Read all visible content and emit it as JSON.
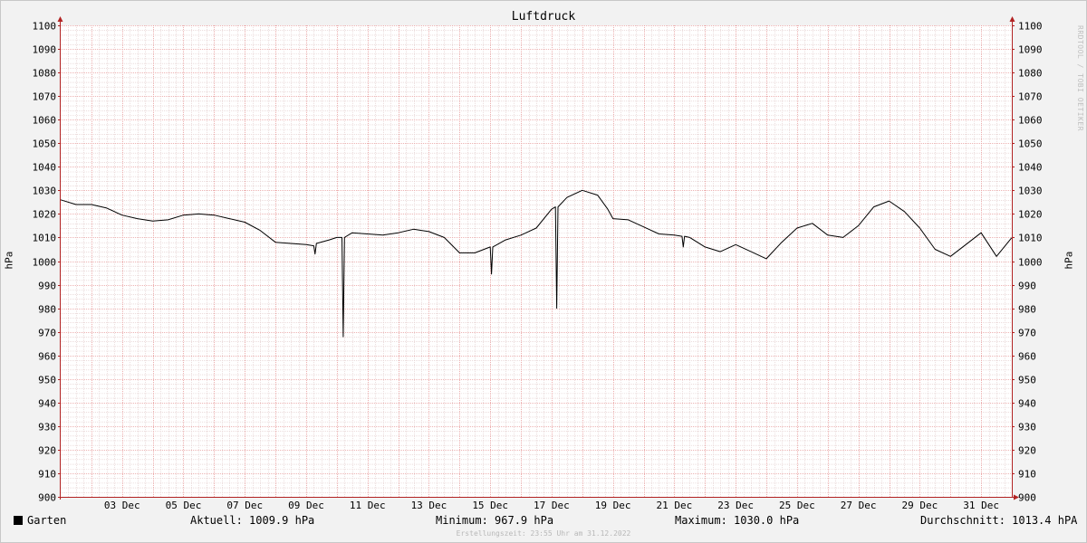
{
  "chart_data": {
    "type": "line",
    "title": "Luftdruck",
    "ylabel": "hPa",
    "ylim": [
      900,
      1100
    ],
    "yticks": [
      900,
      910,
      920,
      930,
      940,
      950,
      960,
      970,
      980,
      990,
      1000,
      1010,
      1020,
      1030,
      1040,
      1050,
      1060,
      1070,
      1080,
      1090,
      1100
    ],
    "xlim": [
      "2022-12-01",
      "2023-01-01"
    ],
    "xticks": [
      {
        "date": "2022-12-03",
        "label": "03 Dec"
      },
      {
        "date": "2022-12-05",
        "label": "05 Dec"
      },
      {
        "date": "2022-12-07",
        "label": "07 Dec"
      },
      {
        "date": "2022-12-09",
        "label": "09 Dec"
      },
      {
        "date": "2022-12-11",
        "label": "11 Dec"
      },
      {
        "date": "2022-12-13",
        "label": "13 Dec"
      },
      {
        "date": "2022-12-15",
        "label": "15 Dec"
      },
      {
        "date": "2022-12-17",
        "label": "17 Dec"
      },
      {
        "date": "2022-12-19",
        "label": "19 Dec"
      },
      {
        "date": "2022-12-21",
        "label": "21 Dec"
      },
      {
        "date": "2022-12-23",
        "label": "23 Dec"
      },
      {
        "date": "2022-12-25",
        "label": "25 Dec"
      },
      {
        "date": "2022-12-27",
        "label": "27 Dec"
      },
      {
        "date": "2022-12-29",
        "label": "29 Dec"
      },
      {
        "date": "2022-12-31",
        "label": "31 Dec"
      }
    ],
    "grid": true,
    "series": [
      {
        "name": "Garten",
        "color": "#000000",
        "x": [
          "2022-12-01 00:00",
          "2022-12-01 12:00",
          "2022-12-02 00:00",
          "2022-12-02 12:00",
          "2022-12-03 00:00",
          "2022-12-03 12:00",
          "2022-12-04 00:00",
          "2022-12-04 12:00",
          "2022-12-05 00:00",
          "2022-12-05 12:00",
          "2022-12-06 00:00",
          "2022-12-06 12:00",
          "2022-12-07 00:00",
          "2022-12-07 12:00",
          "2022-12-08 00:00",
          "2022-12-08 12:00",
          "2022-12-09 00:00",
          "2022-12-09 06:00",
          "2022-12-09 07:00",
          "2022-12-09 08:00",
          "2022-12-09 18:00",
          "2022-12-10 00:00",
          "2022-12-10 04:00",
          "2022-12-10 05:00",
          "2022-12-10 06:00",
          "2022-12-10 12:00",
          "2022-12-11 00:00",
          "2022-12-11 12:00",
          "2022-12-12 00:00",
          "2022-12-12 12:00",
          "2022-12-13 00:00",
          "2022-12-13 12:00",
          "2022-12-14 00:00",
          "2022-12-14 12:00",
          "2022-12-15 00:00",
          "2022-12-15 01:00",
          "2022-12-15 02:00",
          "2022-12-15 12:00",
          "2022-12-16 00:00",
          "2022-12-16 12:00",
          "2022-12-17 00:00",
          "2022-12-17 03:00",
          "2022-12-17 04:00",
          "2022-12-17 05:00",
          "2022-12-17 12:00",
          "2022-12-18 00:00",
          "2022-12-18 12:00",
          "2022-12-18 20:00",
          "2022-12-19 00:00",
          "2022-12-19 12:00",
          "2022-12-20 00:00",
          "2022-12-20 12:00",
          "2022-12-21 00:00",
          "2022-12-21 06:00",
          "2022-12-21 07:00",
          "2022-12-21 08:00",
          "2022-12-21 12:00",
          "2022-12-22 00:00",
          "2022-12-22 12:00",
          "2022-12-23 00:00",
          "2022-12-23 12:00",
          "2022-12-24 00:00",
          "2022-12-24 12:00",
          "2022-12-25 00:00",
          "2022-12-25 12:00",
          "2022-12-26 00:00",
          "2022-12-26 12:00",
          "2022-12-27 00:00",
          "2022-12-27 12:00",
          "2022-12-28 00:00",
          "2022-12-28 12:00",
          "2022-12-29 00:00",
          "2022-12-29 12:00",
          "2022-12-30 00:00",
          "2022-12-30 12:00",
          "2022-12-31 00:00",
          "2022-12-31 12:00",
          "2022-12-31 23:55"
        ],
        "values": [
          1026,
          1024,
          1024,
          1022.5,
          1019.5,
          1018,
          1017,
          1017.5,
          1019.5,
          1020,
          1019.5,
          1018,
          1016.5,
          1013,
          1008,
          1007.5,
          1007,
          1006.5,
          1003,
          1007.5,
          1009,
          1010,
          1010,
          967.9,
          1010,
          1012,
          1011.5,
          1011,
          1012,
          1013.5,
          1012.5,
          1010,
          1003.5,
          1003.5,
          1006,
          994.5,
          1006,
          1009,
          1011,
          1014,
          1022,
          1023,
          980,
          1023,
          1027,
          1030,
          1028,
          1022,
          1018,
          1017.5,
          1014.5,
          1011.5,
          1011,
          1010.5,
          1006,
          1010.5,
          1010,
          1006,
          1004,
          1007,
          1004,
          1001,
          1008,
          1014,
          1016,
          1011,
          1010,
          1015,
          1023,
          1025.5,
          1021,
          1014,
          1005,
          1002,
          1007,
          1012,
          1002,
          1009.9
        ]
      }
    ],
    "stats": [
      {
        "label": "Aktuell:",
        "value": "1009.9 hPa"
      },
      {
        "label": "Minimum:",
        "value": "967.9 hPa"
      },
      {
        "label": "Maximum:",
        "value": "1030.0 hPa"
      },
      {
        "label": "Durchschnitt:",
        "value": "1013.4 hPA"
      }
    ],
    "legend_name": "Garten"
  },
  "footer": "Erstellungszeit: 23:55 Uhr am 31.12.2022",
  "watermark": "RRDTOOL / TOBI OETIKER",
  "colors": {
    "grid_minor": "#e0c8c8",
    "grid_major": "#e89a9a",
    "axis": "#b22222",
    "line": "#000000"
  }
}
